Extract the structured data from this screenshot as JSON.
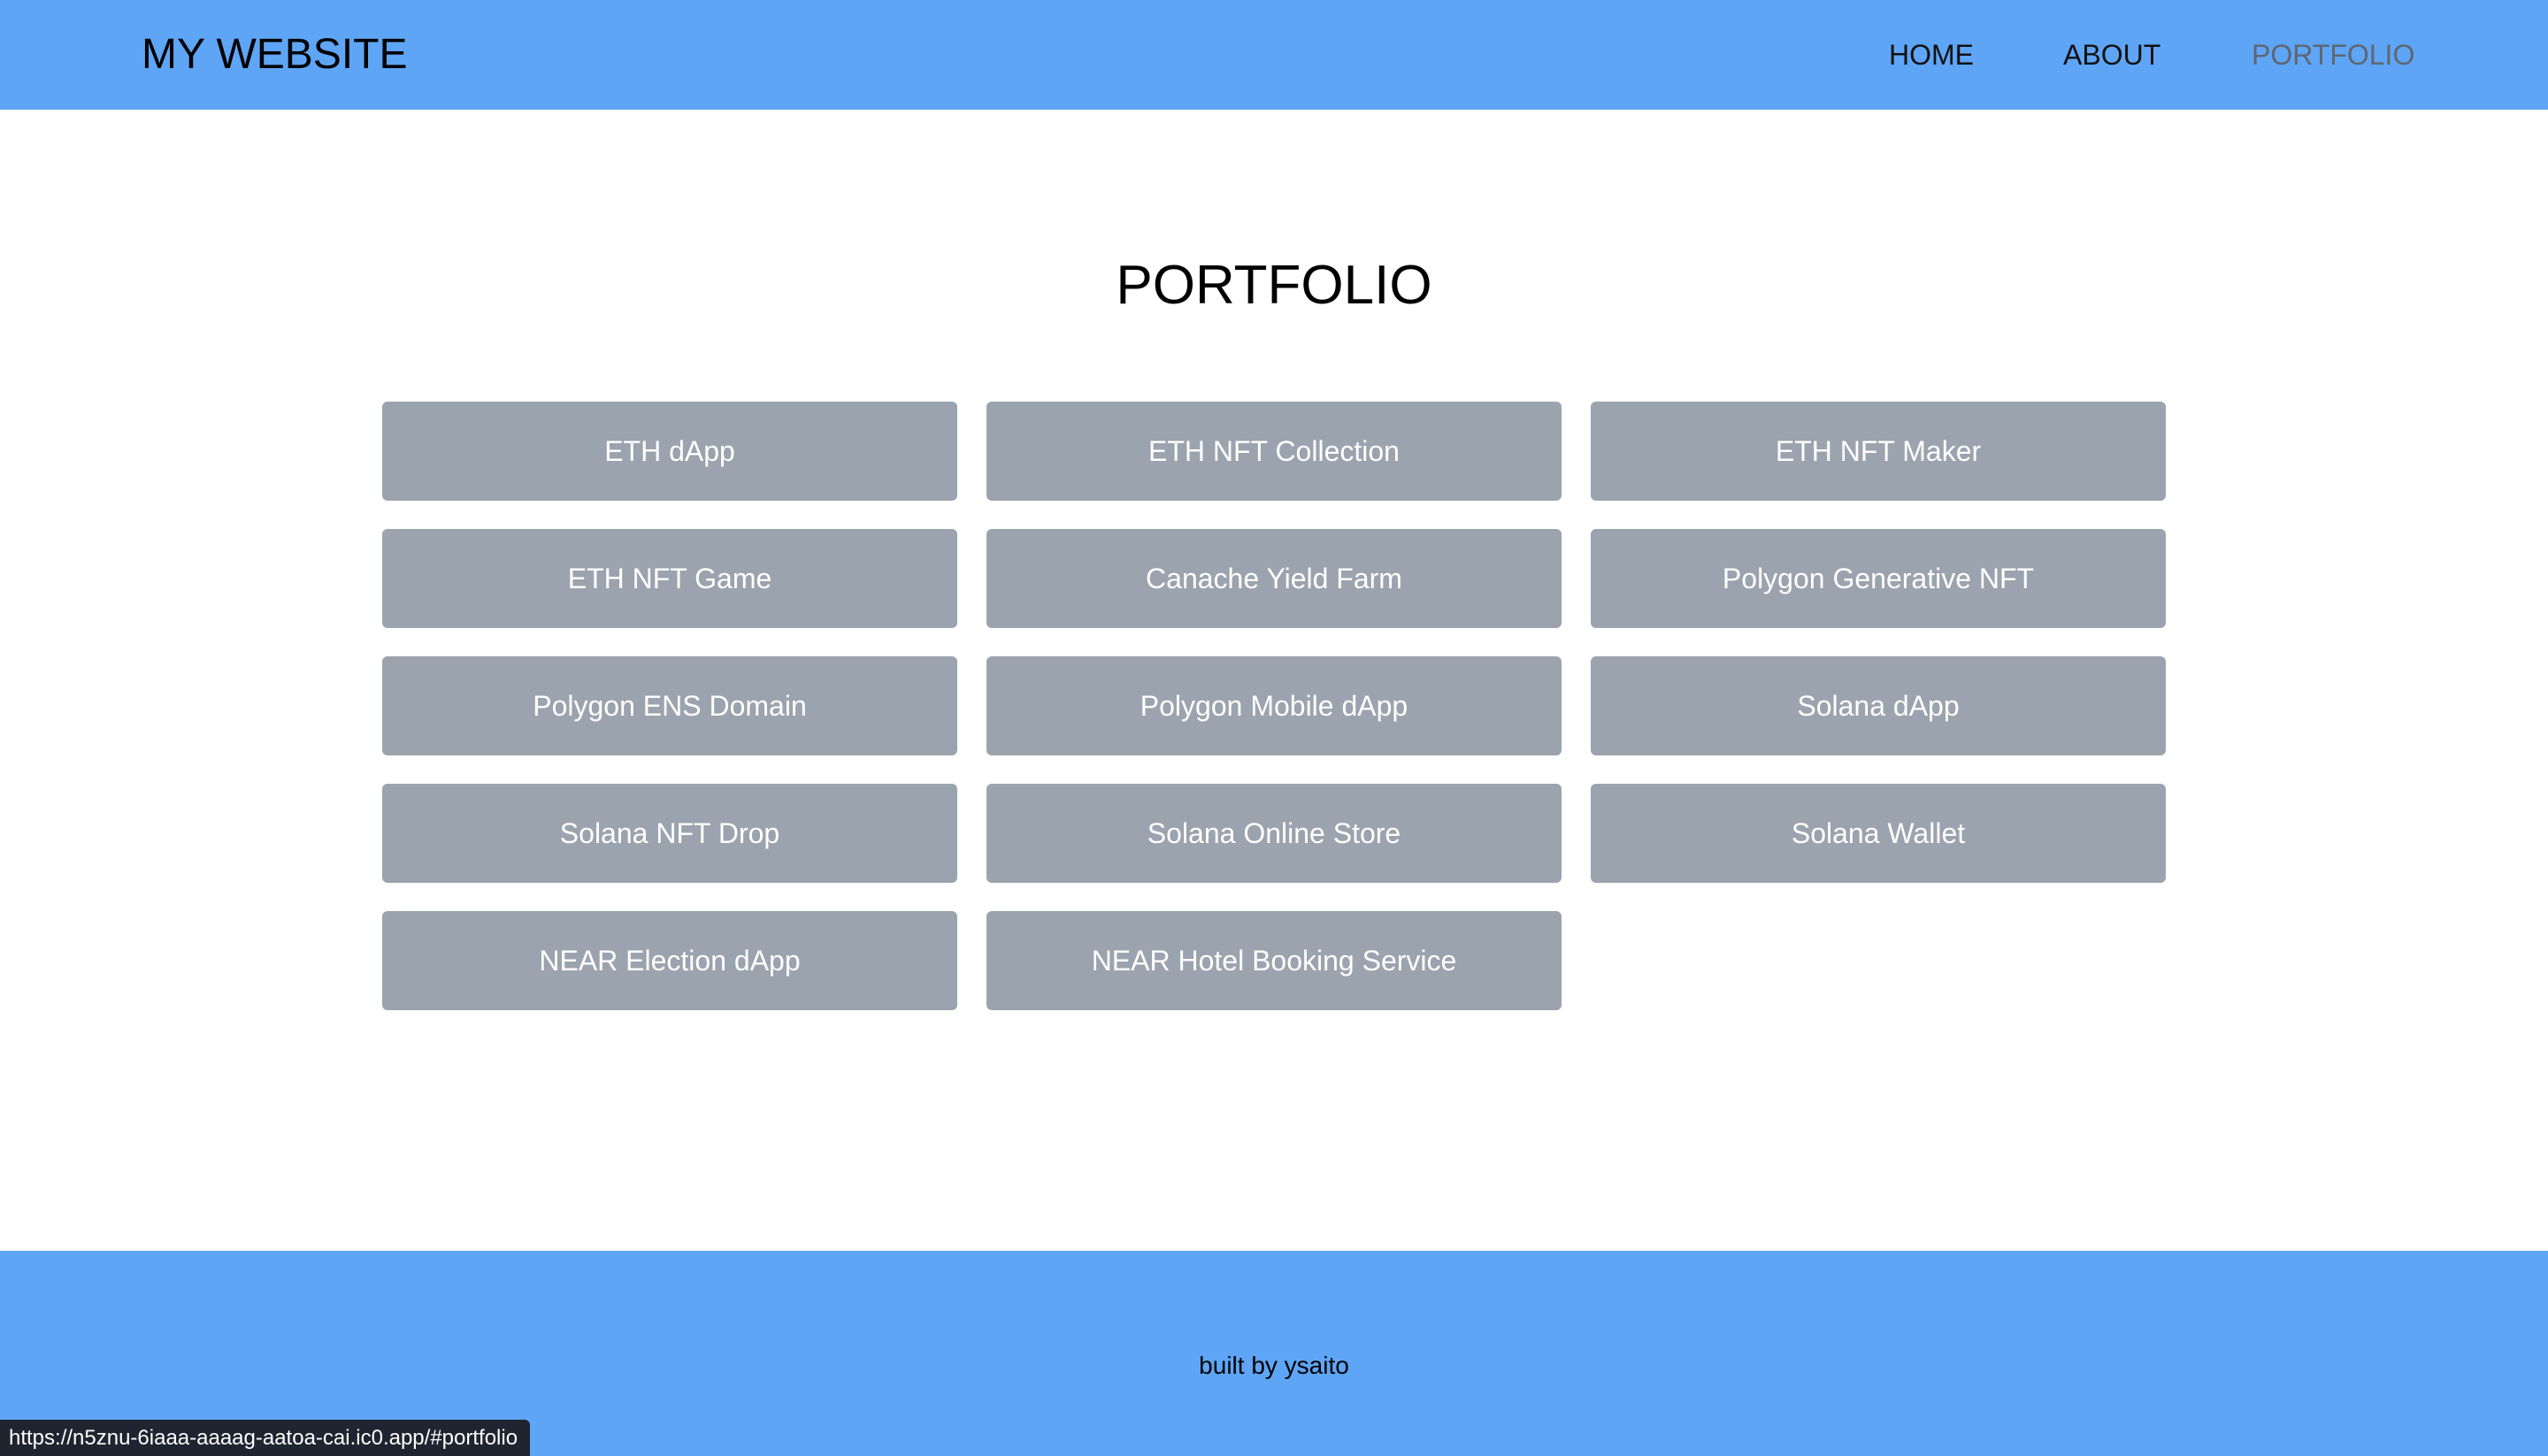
{
  "header": {
    "brand": "MY WEBSITE",
    "nav": [
      {
        "label": "HOME"
      },
      {
        "label": "ABOUT"
      },
      {
        "label": "PORTFOLIO"
      }
    ]
  },
  "main": {
    "title": "PORTFOLIO",
    "projects": [
      "ETH dApp",
      "ETH NFT Collection",
      "ETH NFT Maker",
      "ETH NFT Game",
      "Canache Yield Farm",
      "Polygon Generative NFT",
      "Polygon ENS Domain",
      "Polygon Mobile dApp",
      "Solana dApp",
      "Solana NFT Drop",
      "Solana Online Store",
      "Solana Wallet",
      "NEAR Election dApp",
      "NEAR Hotel Booking Service"
    ]
  },
  "footer": {
    "text": "built by ysaito"
  },
  "status_bar": {
    "url": "https://n5znu-6iaaa-aaaag-aatoa-cai.ic0.app/#portfolio"
  },
  "colors": {
    "header_bg": "#5ea5f5",
    "card_bg": "#9ba3ae",
    "active_nav": "#5f6672"
  }
}
